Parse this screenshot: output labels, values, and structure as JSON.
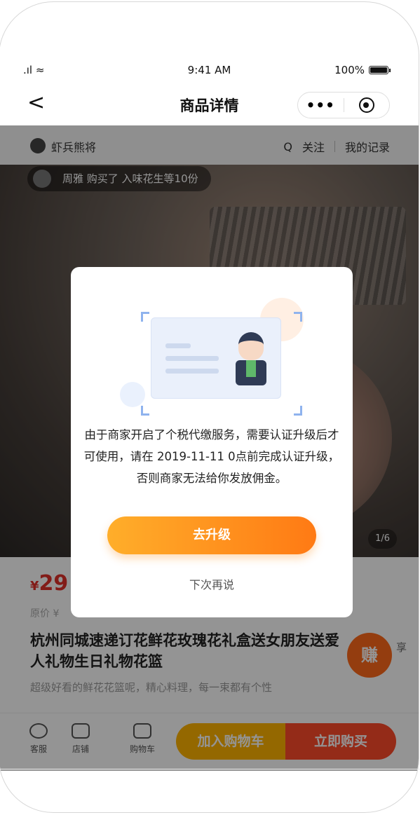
{
  "status_bar": {
    "time": "9:41 AM",
    "battery": "100%",
    "signal": ".ıl ≈"
  },
  "nav": {
    "back": "<",
    "title": "商品详情",
    "more": "•••"
  },
  "shop": {
    "name": "虾兵熊将",
    "search_icon": "Q",
    "follow": "关注",
    "records": "我的记录"
  },
  "hero": {
    "buyer_notice": "周雅 购买了 入味花生等10份",
    "page_indicator": "1/6"
  },
  "product": {
    "price_symbol": "¥",
    "price": "29",
    "original_price": "原价 ¥",
    "title": "杭州同城速递订花鲜花玫瑰花礼盒送女朋友送爱人礼物生日礼物花篮",
    "description": "超级好看的鲜花花篮呢，精心料理，每一束都有个性",
    "share_badge": "赚",
    "share_label": "享"
  },
  "tabbar": {
    "items": [
      {
        "label": "客服",
        "icon": "chat-icon"
      },
      {
        "label": "店铺",
        "icon": "store-icon"
      },
      {
        "label": "购物车",
        "icon": "cart-icon"
      }
    ],
    "add_to_cart": "加入购物车",
    "buy_now": "立即购买"
  },
  "modal": {
    "message": "由于商家开启了个税代缴服务，需要认证升级后才可使用，请在 2019-11-11 0点前完成认证升级，否则商家无法给你发放佣金。",
    "primary_button": "去升级",
    "secondary_button": "下次再说"
  },
  "colors": {
    "accent_orange": "#ff7a14",
    "price_red": "#e0312a",
    "buy_red": "#ff4a2a",
    "cart_yellow": "#ffb300"
  }
}
